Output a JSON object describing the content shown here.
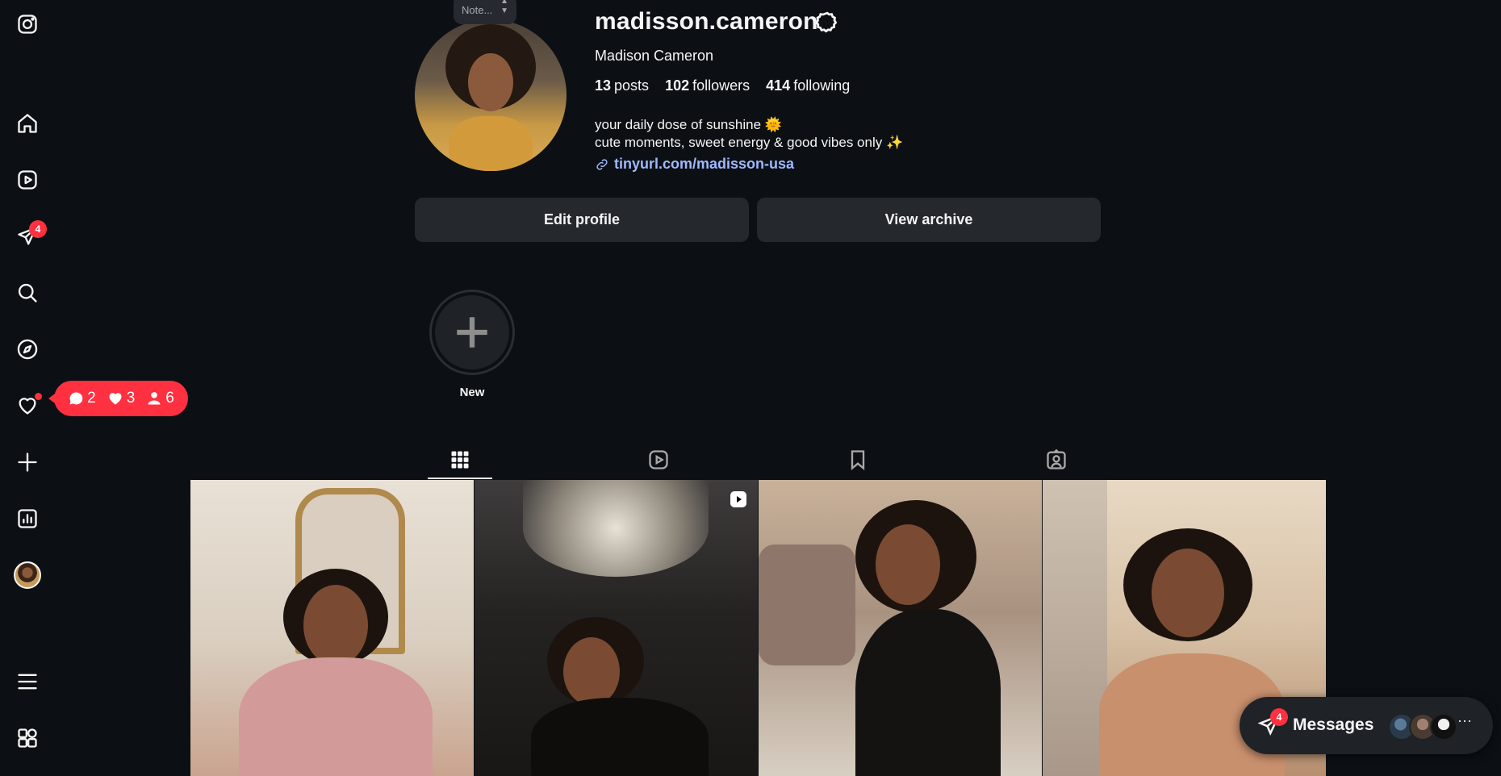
{
  "sidebar": {
    "items": [
      {
        "name": "instagram-icon"
      },
      {
        "name": "home-icon"
      },
      {
        "name": "reels-icon"
      },
      {
        "name": "messages-icon",
        "badge": "4"
      },
      {
        "name": "search-icon"
      },
      {
        "name": "explore-icon"
      },
      {
        "name": "notifications-icon"
      },
      {
        "name": "create-icon"
      },
      {
        "name": "dashboard-icon"
      },
      {
        "name": "profile-icon"
      },
      {
        "name": "menu-icon"
      },
      {
        "name": "more-apps-icon"
      }
    ]
  },
  "notifications_pill": {
    "comments": "2",
    "likes": "3",
    "follows": "6"
  },
  "profile": {
    "note": "Note...",
    "username": "madisson.cameron",
    "full_name": "Madison Cameron",
    "posts_count": "13",
    "posts_label": "posts",
    "followers_count": "102",
    "followers_label": "followers",
    "following_count": "414",
    "following_label": "following",
    "bio_line1": "your daily dose of sunshine 🌞",
    "bio_line2": "cute moments, sweet energy & good vibes only ✨",
    "link": "tinyurl.com/madisson-usa"
  },
  "actions": {
    "edit_profile": "Edit profile",
    "view_archive": "View archive"
  },
  "highlights": {
    "new_label": "New"
  },
  "tabs": [
    {
      "name": "posts-tab",
      "active": true
    },
    {
      "name": "reels-tab",
      "active": false
    },
    {
      "name": "saved-tab",
      "active": false
    },
    {
      "name": "tagged-tab",
      "active": false
    }
  ],
  "messages": {
    "label": "Messages",
    "badge": "4"
  },
  "colors": {
    "background": "#0c1014",
    "badge_red": "#ff3040",
    "button_bg": "#25292e",
    "link_blue": "#a0b8ff"
  }
}
